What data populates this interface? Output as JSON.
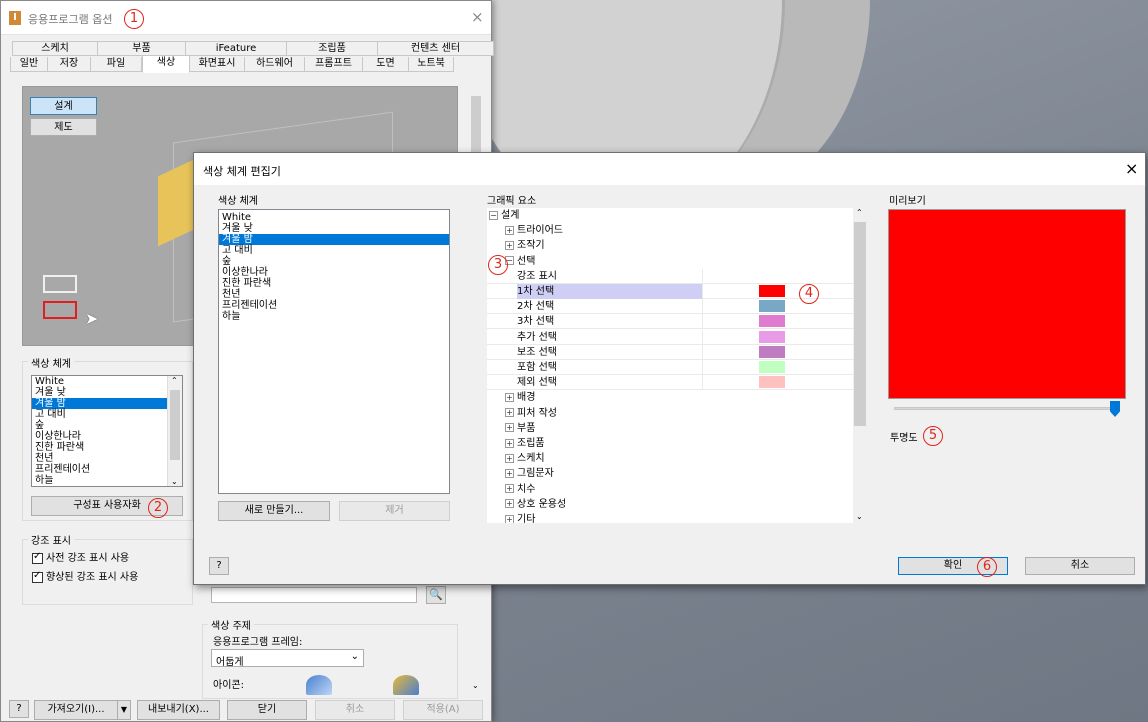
{
  "options_window": {
    "title": "응용프로그램 옵션",
    "tabs_row1": [
      "스케치",
      "부품",
      "iFeature",
      "조립품",
      "컨텐츠 센터"
    ],
    "tabs_row2": [
      "일반",
      "저장",
      "파일",
      "색상",
      "화면표시",
      "하드웨어",
      "프롬프트",
      "도면",
      "노트북"
    ],
    "active_tab": "색상",
    "preview_buttons": {
      "design": "설계",
      "drawing": "제도"
    },
    "color_scheme_label": "색상 체계",
    "color_scheme_items": [
      "White",
      "겨울 낮",
      "겨울 밤",
      "고 대비",
      "숲",
      "이상한나라",
      "진한 파란색",
      "천년",
      "프리젠테이션",
      "하늘"
    ],
    "selected_scheme": "겨울 밤",
    "customize_button": "구성표 사용자화",
    "highlight_label": "강조 표시",
    "checkbox_pre": "사전 강조 표시 사용",
    "checkbox_enhanced": "향상된 강조 표시 사용",
    "color_theme_label": "색상 주제",
    "app_frame_label": "응용프로그램 프레임:",
    "app_frame_value": "어둡게",
    "icon_label": "아이콘:",
    "footer": {
      "import": "가져오기(I)...",
      "export": "내보내기(X)...",
      "close": "닫기",
      "cancel": "취소",
      "apply": "적용(A)"
    }
  },
  "editor_dialog": {
    "title": "색상 체계 편집기",
    "scheme_label": "색상 체계",
    "scheme_items": [
      "White",
      "겨울 낮",
      "겨울 밤",
      "고 대비",
      "숲",
      "이상한나라",
      "진한 파란색",
      "천년",
      "프리젠테이션",
      "하늘"
    ],
    "selected_scheme": "겨울 밤",
    "new_button": "새로 만들기...",
    "remove_button": "제거",
    "graphics_label": "그래픽 요소",
    "tree": {
      "design": "설계",
      "triad": "트라이어드",
      "manipulator": "조작기",
      "selection": "선택",
      "highlight": "강조 표시",
      "selection_rows": [
        {
          "label": "1차 선택",
          "color": "#ff0000"
        },
        {
          "label": "2차 선택",
          "color": "#78a8c6"
        },
        {
          "label": "3차 선택",
          "color": "#e07cd0"
        },
        {
          "label": "추가 선택",
          "color": "#e89ce8"
        },
        {
          "label": "보조 선택",
          "color": "#c07cc0"
        },
        {
          "label": "포함 선택",
          "color": "#c0ffc0"
        },
        {
          "label": "제외 선택",
          "color": "#ffc0c0"
        }
      ],
      "more_items": [
        "배경",
        "피처 작성",
        "부품",
        "조립품",
        "스케치",
        "그림문자",
        "치수",
        "상호 운용성",
        "기타"
      ]
    },
    "preview_label": "미리보기",
    "preview_color": "#ff0000",
    "transparency_label": "투명도",
    "transparency_fraction": 1.0,
    "ok_button": "확인",
    "cancel_button": "취소"
  },
  "markers": [
    "1",
    "2",
    "3",
    "4",
    "5",
    "6"
  ],
  "colors": {
    "selection_blue": "#0078d7",
    "highlight_row": "#cfcff5",
    "marker_red": "#e0261b"
  }
}
